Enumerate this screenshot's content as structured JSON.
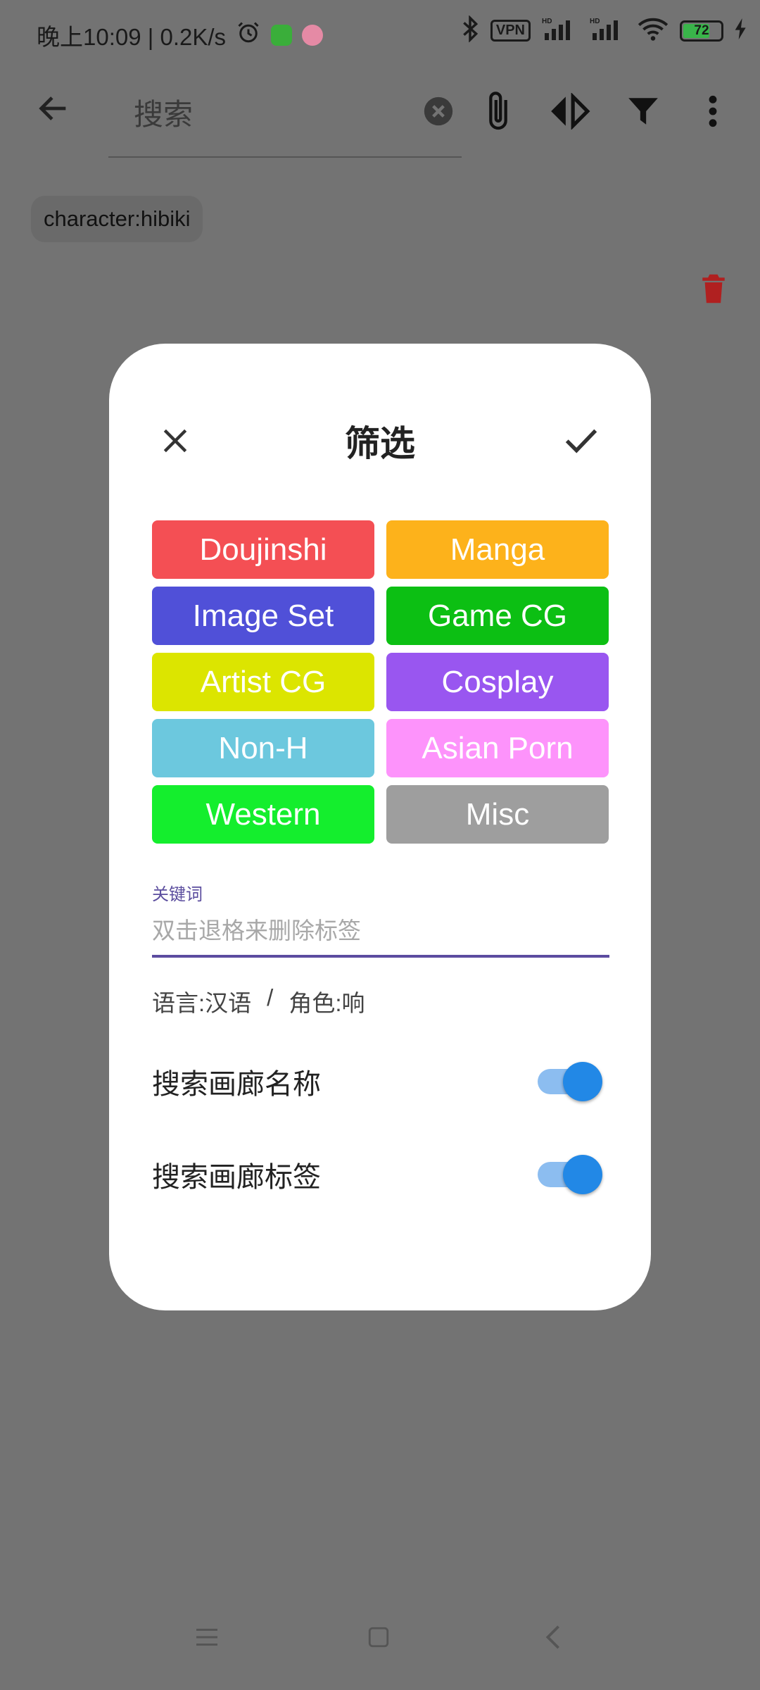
{
  "status_bar": {
    "time_speed": "晚上10:09 | 0.2K/s",
    "vpn": "VPN",
    "battery": "72",
    "battery_level": 0.72
  },
  "app_bar": {
    "search_placeholder": "搜索",
    "icons": [
      "back-arrow-icon",
      "clear-icon",
      "attachment-icon",
      "compare-icon",
      "filter-icon",
      "more-vert-icon"
    ]
  },
  "chips": [
    {
      "label": "character:hibiki"
    }
  ],
  "dialog": {
    "title": "筛选",
    "categories": [
      {
        "label": "Doujinshi",
        "color": "#f44f54"
      },
      {
        "label": "Manga",
        "color": "#fdb21b"
      },
      {
        "label": "Image Set",
        "color": "#5050d8"
      },
      {
        "label": "Game CG",
        "color": "#0cbf13"
      },
      {
        "label": "Artist CG",
        "color": "#dce500"
      },
      {
        "label": "Cosplay",
        "color": "#9956f0"
      },
      {
        "label": "Non-H",
        "color": "#6cc8de"
      },
      {
        "label": "Asian Porn",
        "color": "#fd93fb"
      },
      {
        "label": "Western",
        "color": "#14ee2d"
      },
      {
        "label": "Misc",
        "color": "#9e9e9e"
      }
    ],
    "keyword_label": "关键词",
    "keyword_placeholder": "双击退格来删除标签",
    "tag_language": "语言:汉语",
    "tag_separator": "/",
    "tag_character": "角色:响",
    "toggle_gallery_name": {
      "label": "搜索画廊名称",
      "on": true
    },
    "toggle_gallery_tags": {
      "label": "搜索画廊标签",
      "on": true
    }
  },
  "colors": {
    "scrim": "#737373",
    "accent": "#5c4ca0",
    "switch_on": "#2288e6",
    "delete_red": "#b02020"
  }
}
